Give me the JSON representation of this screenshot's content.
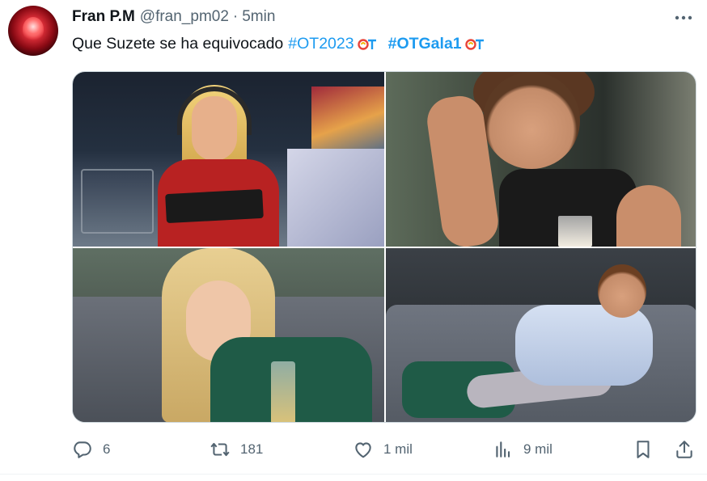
{
  "tweet": {
    "author": {
      "display_name": "Fran P.M",
      "handle": "@fran_pm02",
      "separator": "·",
      "time": "5min"
    },
    "text": {
      "plain": "Que Suzete se ha equivocado",
      "hashtag_1": "#OT2023",
      "hashtag_2": "#OTGala1"
    },
    "hashtag_color": "#1d9bf0",
    "media": [
      {
        "alt": "photo-1"
      },
      {
        "alt": "photo-2"
      },
      {
        "alt": "photo-3"
      },
      {
        "alt": "photo-4"
      }
    ]
  },
  "actions": {
    "reply": {
      "icon": "reply-icon",
      "count": "6"
    },
    "retweet": {
      "icon": "retweet-icon",
      "count": "181"
    },
    "like": {
      "icon": "heart-icon",
      "count": "1 mil"
    },
    "views": {
      "icon": "views-icon",
      "count": "9 mil"
    },
    "bookmark": {
      "icon": "bookmark-icon"
    },
    "share": {
      "icon": "share-icon"
    }
  },
  "colors": {
    "text_primary": "#0f1419",
    "text_secondary": "#536471",
    "accent": "#1d9bf0",
    "border": "#cfd9de"
  }
}
